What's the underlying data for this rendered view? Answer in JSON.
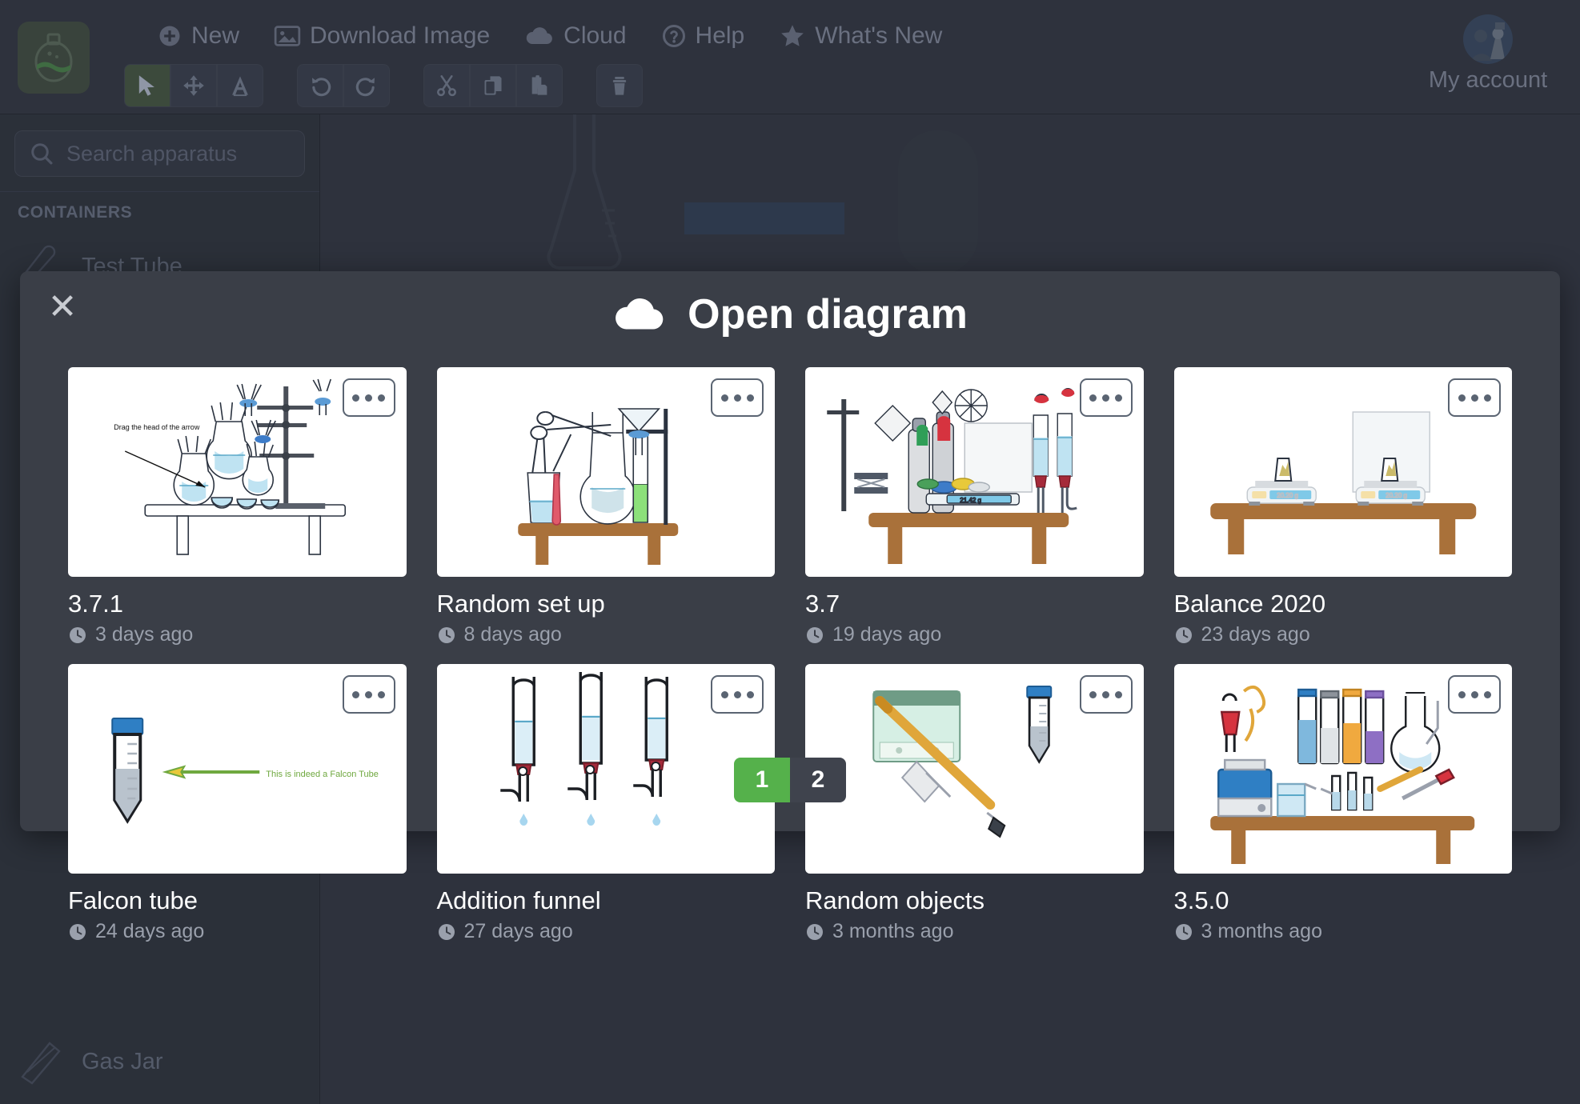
{
  "app": {
    "logo_icon": "flask-logo-icon",
    "menu": [
      {
        "label": "New",
        "icon": "plus-circle-icon"
      },
      {
        "label": "Download Image",
        "icon": "image-icon"
      },
      {
        "label": "Cloud",
        "icon": "cloud-icon"
      },
      {
        "label": "Help",
        "icon": "question-circle-icon"
      },
      {
        "label": "What's New",
        "icon": "star-icon"
      }
    ],
    "tools": [
      {
        "name": "select-tool",
        "icon": "cursor-icon",
        "active": true
      },
      {
        "name": "move-tool",
        "icon": "move-arrows-icon",
        "active": false
      },
      {
        "name": "text-tool",
        "icon": "text-a-icon",
        "active": false
      },
      {
        "name": "undo-tool",
        "icon": "undo-icon",
        "active": false
      },
      {
        "name": "redo-tool",
        "icon": "redo-icon",
        "active": false
      },
      {
        "name": "cut-tool",
        "icon": "scissors-icon",
        "active": false
      },
      {
        "name": "copy-tool",
        "icon": "copy-icon",
        "active": false
      },
      {
        "name": "paste-tool",
        "icon": "paste-icon",
        "active": false
      },
      {
        "name": "delete-tool",
        "icon": "trash-icon",
        "active": false
      }
    ],
    "account": {
      "label": "My account"
    }
  },
  "sidebar": {
    "search": {
      "placeholder": "Search apparatus",
      "value": ""
    },
    "section_label": "CONTAINERS",
    "items": [
      {
        "label": "Test Tube"
      },
      {
        "label": "Gas Jar"
      }
    ]
  },
  "modal": {
    "title": "Open diagram",
    "title_icon": "cloud-icon",
    "close_icon": "close-icon",
    "cards": [
      {
        "title": "3.7.1",
        "time": "3 days ago",
        "annotation": "Drag the head of the arrow",
        "menu_icon": "ellipsis-icon",
        "clock_icon": "clock-icon"
      },
      {
        "title": "Random set up",
        "time": "8 days ago",
        "annotation": "",
        "menu_icon": "ellipsis-icon",
        "clock_icon": "clock-icon"
      },
      {
        "title": "3.7",
        "time": "19 days ago",
        "annotation": "21.42 g",
        "menu_icon": "ellipsis-icon",
        "clock_icon": "clock-icon"
      },
      {
        "title": "Balance 2020",
        "time": "23 days ago",
        "annotation": "20.20 g",
        "menu_icon": "ellipsis-icon",
        "clock_icon": "clock-icon"
      },
      {
        "title": "Falcon tube",
        "time": "24 days ago",
        "annotation": "This is indeed a Falcon Tube",
        "menu_icon": "ellipsis-icon",
        "clock_icon": "clock-icon"
      },
      {
        "title": "Addition funnel",
        "time": "27 days ago",
        "annotation": "",
        "menu_icon": "ellipsis-icon",
        "clock_icon": "clock-icon"
      },
      {
        "title": "Random objects",
        "time": "3 months ago",
        "annotation": "",
        "menu_icon": "ellipsis-icon",
        "clock_icon": "clock-icon"
      },
      {
        "title": "3.5.0",
        "time": "3 months ago",
        "annotation": "",
        "menu_icon": "ellipsis-icon",
        "clock_icon": "clock-icon"
      }
    ],
    "pagination": {
      "pages": [
        "1",
        "2"
      ],
      "current": "1"
    }
  },
  "colors": {
    "accent_green": "#55b14b",
    "modal_bg": "#3a3e47",
    "app_bg": "#2e323d",
    "sidebar_bg": "#2b3039",
    "text_muted": "#9aa0ac"
  }
}
